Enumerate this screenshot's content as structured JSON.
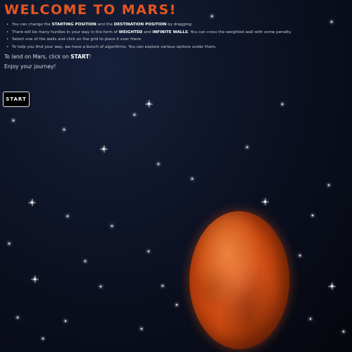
{
  "header": {
    "title": "WELCOME TO MARS!"
  },
  "instructions": {
    "bullets": [
      {
        "pre": "You can change the ",
        "b1": "STARTING POSITION",
        "mid": " and the ",
        "b2": "DESTINATION POSITION",
        "post": " by dragging."
      },
      {
        "pre": "There will be many hurdles in your way in the form of ",
        "b1": "WEIGHTED",
        "mid": " and ",
        "b2": "INFINITE WALLS",
        "post": ". You can cross the weighted wall with some penalty."
      },
      {
        "text": "Select one of the walls and click on the grid to place it over there."
      },
      {
        "text": "To help you find your way, we have a bunch of algorithms. You can explore various options under them."
      }
    ],
    "land_pre": "To land on Mars, click on ",
    "land_bold": "START",
    "land_post": "!",
    "enjoy": "Enjoy your journey!"
  },
  "start_button": {
    "label": "START"
  },
  "theme": {
    "title_color": "#e8551f",
    "background": "#0b1020",
    "planet_color": "#d1531b"
  },
  "icons": {
    "planet": "mars-planet-icon",
    "stars": "star-icon"
  }
}
